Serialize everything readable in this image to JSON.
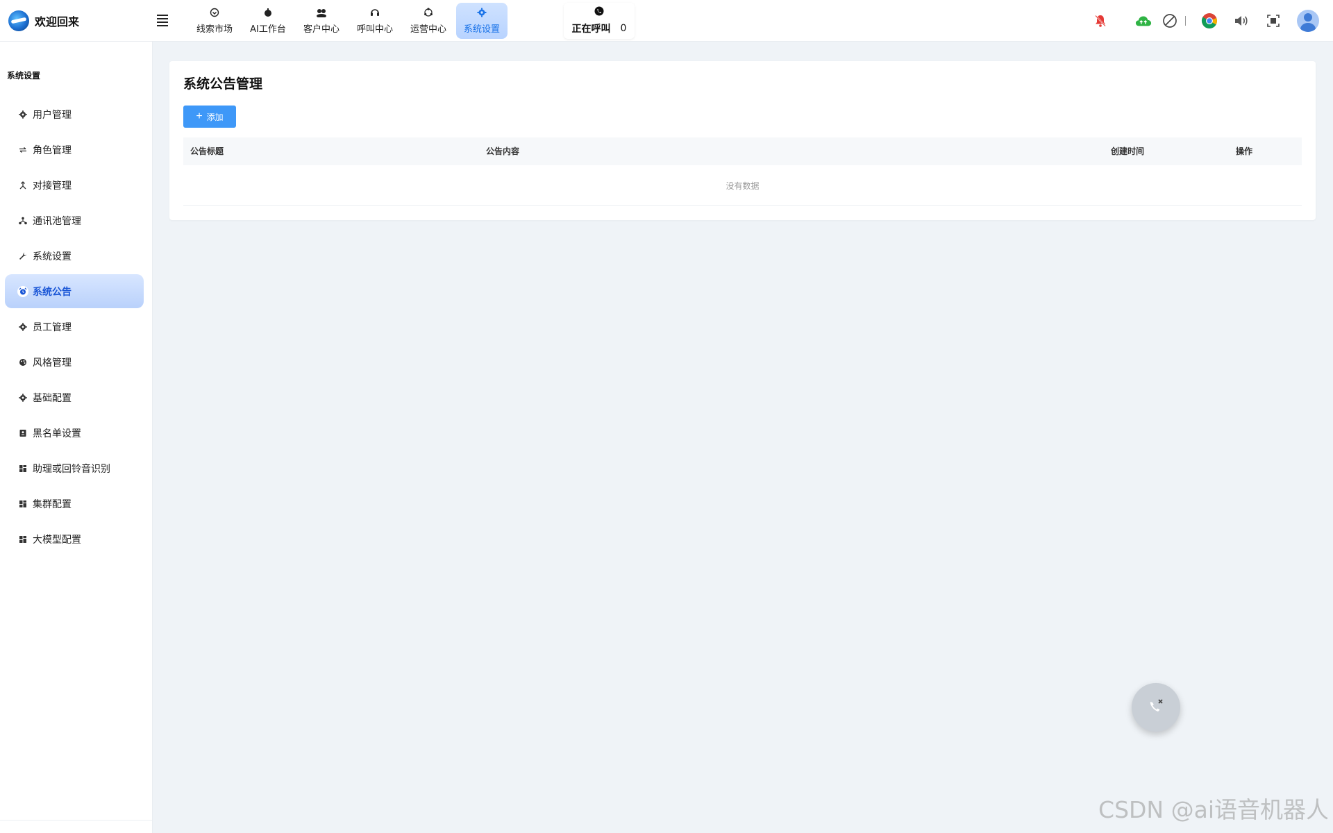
{
  "header": {
    "brand_title": "欢迎回来",
    "nav": [
      {
        "label": "线索市场",
        "icon": "clue-market-icon"
      },
      {
        "label": "AI工作台",
        "icon": "ai-bot-icon"
      },
      {
        "label": "客户中心",
        "icon": "customers-icon"
      },
      {
        "label": "呼叫中心",
        "icon": "headset-icon"
      },
      {
        "label": "运营中心",
        "icon": "operations-icon"
      },
      {
        "label": "系统设置",
        "icon": "gear-icon",
        "active": true
      }
    ],
    "calling": {
      "label": "正在呼叫",
      "count": "0"
    }
  },
  "sidebar": {
    "title": "系统设置",
    "items": [
      {
        "label": "用户管理",
        "icon": "gear-icon"
      },
      {
        "label": "角色管理",
        "icon": "swap-icon"
      },
      {
        "label": "对接管理",
        "icon": "link-icon"
      },
      {
        "label": "通讯池管理",
        "icon": "network-icon"
      },
      {
        "label": "系统设置",
        "icon": "wrench-icon"
      },
      {
        "label": "系统公告",
        "icon": "alarm-icon",
        "active": true
      },
      {
        "label": "员工管理",
        "icon": "gear-icon"
      },
      {
        "label": "风格管理",
        "icon": "palette-icon"
      },
      {
        "label": "基础配置",
        "icon": "gear-icon"
      },
      {
        "label": "黑名单设置",
        "icon": "contact-card-icon"
      },
      {
        "label": "助理或回铃音识别",
        "icon": "dashboard-icon"
      },
      {
        "label": "集群配置",
        "icon": "dashboard-icon"
      },
      {
        "label": "大模型配置",
        "icon": "dashboard-icon"
      }
    ]
  },
  "main": {
    "page_title": "系统公告管理",
    "add_button": "添加",
    "table": {
      "columns": [
        "公告标题",
        "公告内容",
        "创建时间",
        "操作"
      ],
      "empty_text": "没有数据"
    }
  },
  "watermark": "CSDN @ai语音机器人",
  "colors": {
    "accent": "#1a73e8",
    "add_button": "#3e98f8",
    "active_bg": "#c4dafc",
    "bell_red": "#e53935",
    "cloud_green": "#2fb344"
  }
}
